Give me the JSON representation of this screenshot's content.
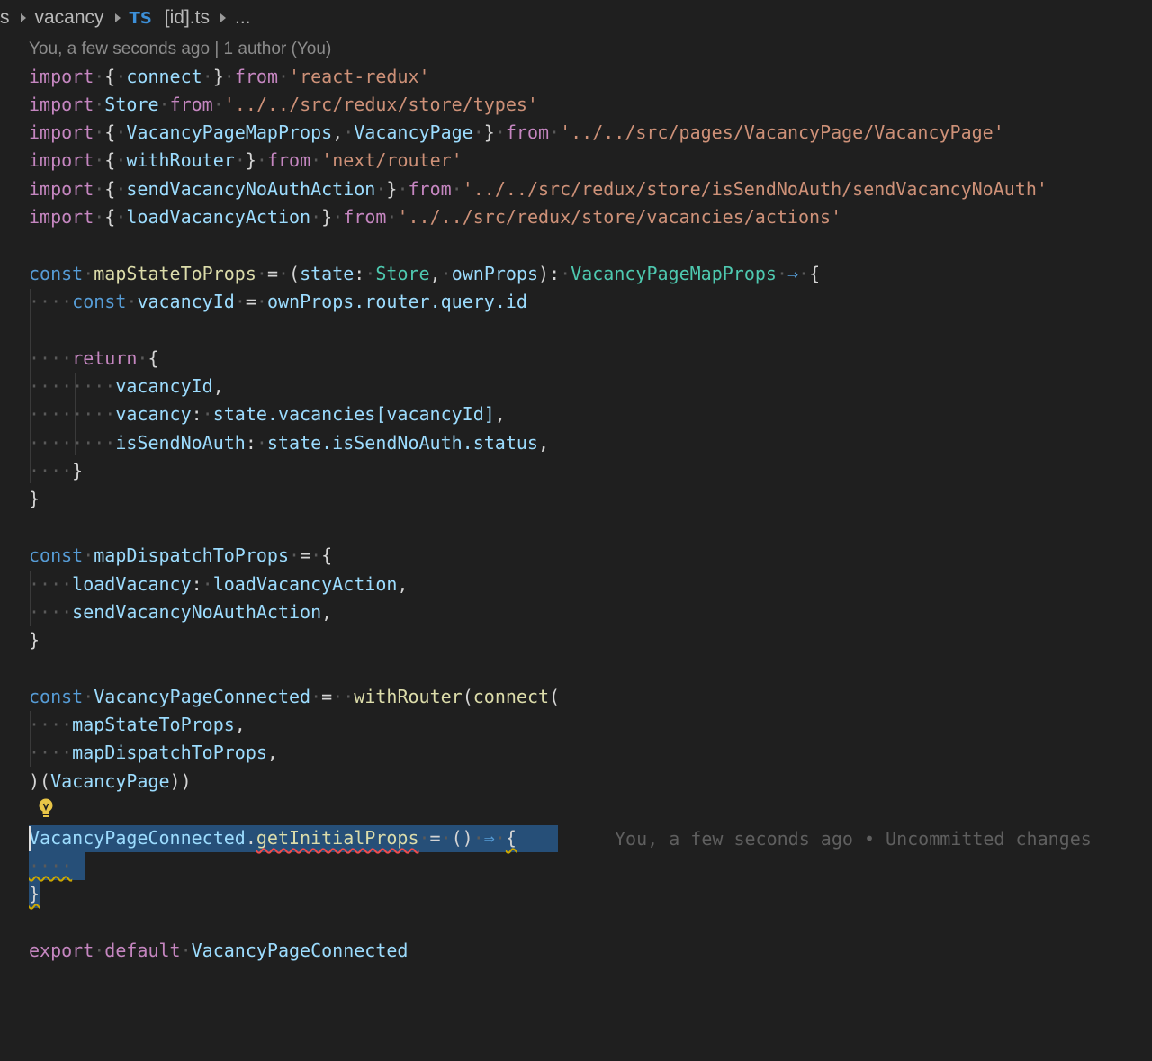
{
  "breadcrumb": {
    "partial": "s",
    "folder": "vacancy",
    "lang_badge": "TS",
    "file": "[id].ts",
    "more": "..."
  },
  "blame_header": "You, a few seconds ago | 1 author (You)",
  "inline_blame": "You, a few seconds ago • Uncommitted changes",
  "icons": {
    "lightbulb": "lightbulb-icon",
    "chevron": "chevron-right-icon"
  },
  "colors": {
    "background": "#1f1f1f",
    "keyword": "#c586c0",
    "storage": "#569cd6",
    "variable": "#9cdcfe",
    "function": "#dcdcaa",
    "type": "#4ec9b0",
    "string": "#ce9178",
    "selection": "#264f78",
    "lightbulb": "#e8c547"
  },
  "code": {
    "l1": {
      "a": "import",
      "b": "connect",
      "c": "from",
      "d": "'react-redux'"
    },
    "l2": {
      "a": "import",
      "b": "Store",
      "c": "from",
      "d": "'../../src/redux/store/types'"
    },
    "l3": {
      "a": "import",
      "b": "VacancyPageMapProps",
      "b2": "VacancyPage",
      "c": "from",
      "d": "'../../src/pages/VacancyPage/VacancyPage'"
    },
    "l4": {
      "a": "import",
      "b": "withRouter",
      "c": "from",
      "d": "'next/router'"
    },
    "l5": {
      "a": "import",
      "b": "sendVacancyNoAuthAction",
      "c": "from",
      "d": "'../../src/redux/store/isSendNoAuth/sendVacancyNoAuth'"
    },
    "l6": {
      "a": "import",
      "b": "loadVacancyAction",
      "c": "from",
      "d": "'../../src/redux/store/vacancies/actions'"
    },
    "l7": {
      "const": "const",
      "name": "mapStateToProps",
      "p1": "state",
      "t1": "Store",
      "p2": "ownProps",
      "t2": "VacancyPageMapProps"
    },
    "l8": {
      "const": "const",
      "name": "vacancyId",
      "rhs": "ownProps.router.query.id"
    },
    "l9": {
      "kw": "return"
    },
    "l10": {
      "prop": "vacancyId"
    },
    "l11": {
      "prop": "vacancy",
      "val": "state.vacancies[vacancyId]"
    },
    "l12": {
      "prop": "isSendNoAuth",
      "val": "state.isSendNoAuth.status"
    },
    "l13": {
      "const": "const",
      "name": "mapDispatchToProps"
    },
    "l14": {
      "prop": "loadVacancy",
      "val": "loadVacancyAction"
    },
    "l15": {
      "prop": "sendVacancyNoAuthAction"
    },
    "l16": {
      "const": "const",
      "name": "VacancyPageConnected",
      "f1": "withRouter",
      "f2": "connect"
    },
    "l17": {
      "arg": "mapStateToProps"
    },
    "l18": {
      "arg": "mapDispatchToProps"
    },
    "l19": {
      "arg": "VacancyPage"
    },
    "l20": {
      "obj": "VacancyPageConnected",
      "prop": "getInitialProps"
    },
    "l21": {
      "a": "export",
      "b": "default",
      "c": "VacancyPageConnected"
    }
  }
}
